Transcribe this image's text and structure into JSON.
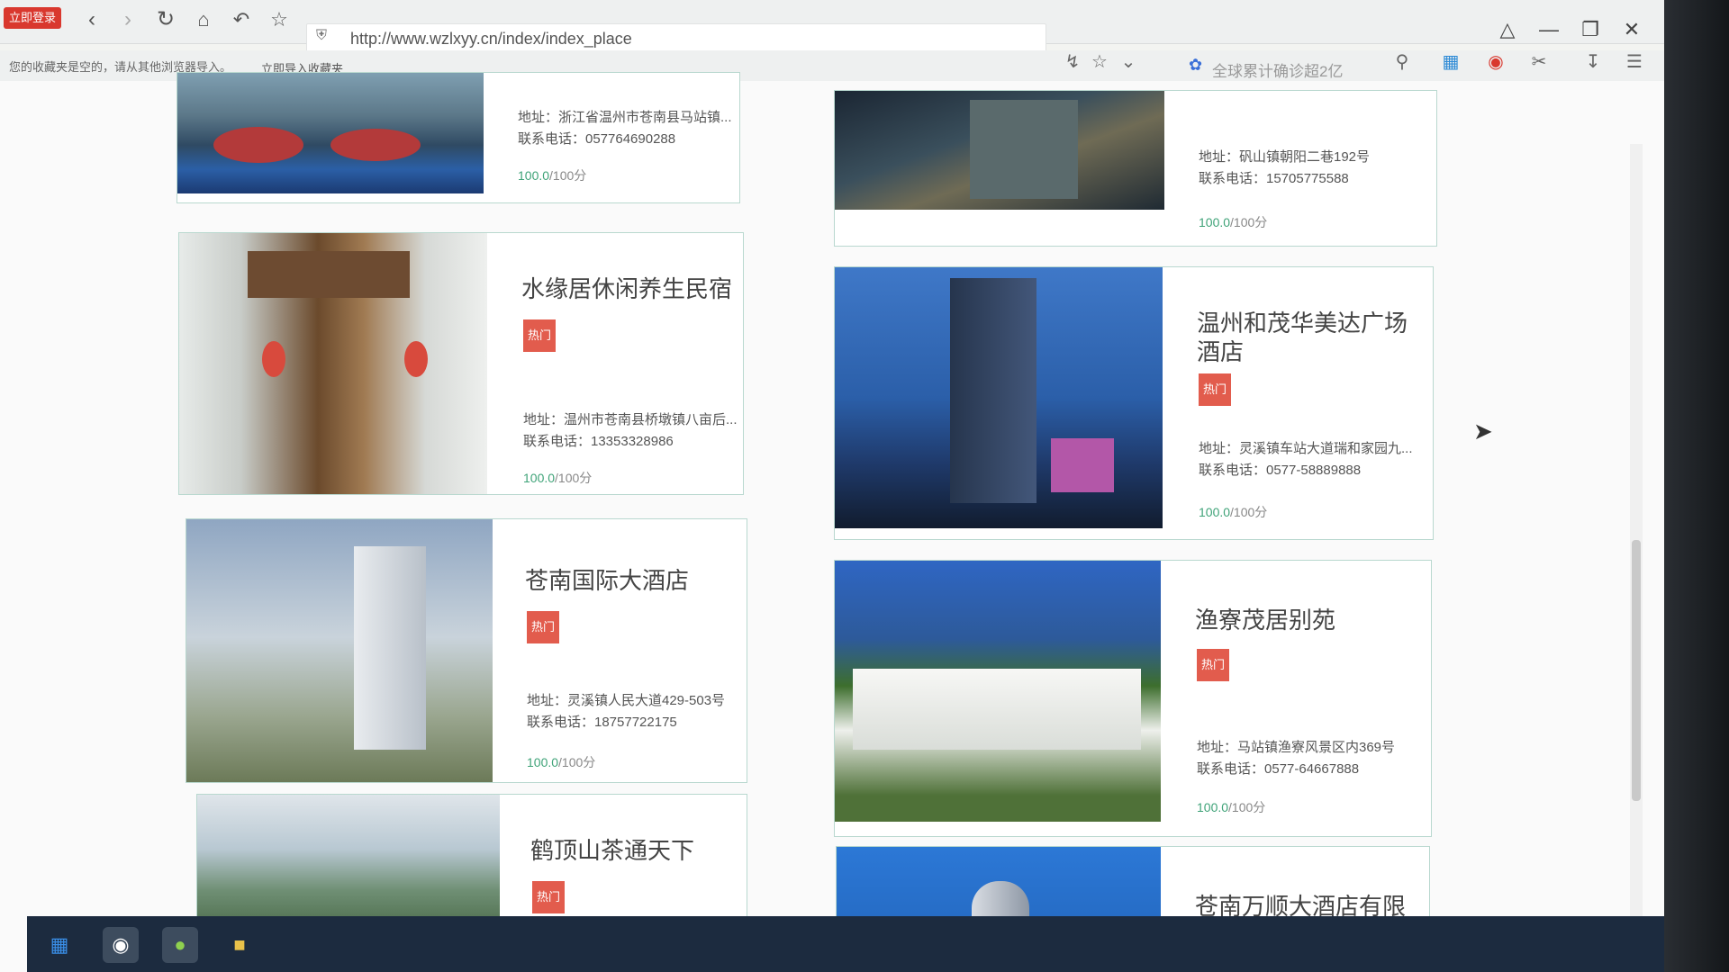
{
  "browser": {
    "login_label": "立即登录",
    "url": "http://www.wzlxyy.cn/index/index_place",
    "bookmarks_hint": "您的收藏夹是空的，请从其他浏览器导入。",
    "bookmarks_import": "立即导入收藏夹",
    "search_placeholder": "全球累计确诊超2亿"
  },
  "icons": {
    "back": "back-icon",
    "forward": "forward-icon",
    "refresh": "refresh-icon",
    "home": "home-icon",
    "undo": "undo-icon",
    "star": "star-icon",
    "search": "search-icon",
    "menu": "menu-icon"
  },
  "colors": {
    "hot_badge": "#e25c4d",
    "card_border": "#b9d8cf",
    "score_green": "#3fa378",
    "login_red": "#d9382e",
    "taskbar": "#1c2b3f"
  },
  "places": [
    {
      "name": "",
      "hot": "",
      "address": "地址：浙江省温州市苍南县马站镇...",
      "tel": "联系电话：057764690288",
      "score": "100.0",
      "score_max": "/100分"
    },
    {
      "name": "",
      "hot": "",
      "address": "地址：矾山镇朝阳二巷192号",
      "tel": "联系电话：15705775588",
      "score": "100.0",
      "score_max": "/100分"
    },
    {
      "name": "水缘居休闲养生民宿",
      "hot": "热门",
      "address": "地址：温州市苍南县桥墩镇八亩后...",
      "tel": "联系电话：13353328986",
      "score": "100.0",
      "score_max": "/100分"
    },
    {
      "name": "温州和茂华美达广场酒店",
      "hot": "热门",
      "address": "地址：灵溪镇车站大道瑞和家园九...",
      "tel": "联系电话：0577-58889888",
      "score": "100.0",
      "score_max": "/100分"
    },
    {
      "name": "苍南国际大酒店",
      "hot": "热门",
      "address": "地址：灵溪镇人民大道429-503号",
      "tel": "联系电话：18757722175",
      "score": "100.0",
      "score_max": "/100分"
    },
    {
      "name": "渔寮茂居别苑",
      "hot": "热门",
      "address": "地址：马站镇渔寮风景区内369号",
      "tel": "联系电话：0577-64667888",
      "score": "100.0",
      "score_max": "/100分"
    },
    {
      "name": "鹤顶山茶通天下",
      "hot": "热门",
      "address": "",
      "tel": "",
      "score": "",
      "score_max": ""
    },
    {
      "name": "苍南万顺大酒店有限公司",
      "hot": "",
      "address": "",
      "tel": "",
      "score": "",
      "score_max": ""
    }
  ]
}
